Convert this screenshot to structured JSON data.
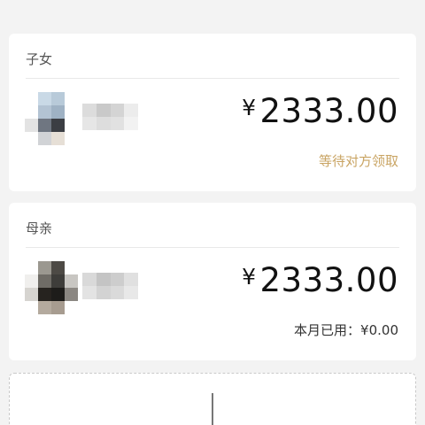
{
  "accounts": [
    {
      "relation": "子女",
      "currency": "¥",
      "amount": "2333.00",
      "status": "等待对方领取",
      "avatar_colors": [
        "#ffffff",
        "#c9d9e6",
        "#b8cad9",
        "#ffffff",
        "#ffffff",
        "#b3c3d3",
        "#9fb2c4",
        "#ffffff",
        "#e3e3e3",
        "#6f7681",
        "#3b3e43",
        "#ffffff",
        "#ffffff",
        "#d1d3d6",
        "#e6dfd6",
        "#ffffff"
      ],
      "name_blur_colors": [
        "#dcdcdc",
        "#c9c9c9",
        "#d4d4d4",
        "#ececec",
        "#e6e6e6",
        "#dddddd",
        "#e1e1e1",
        "#f2f2f2"
      ]
    },
    {
      "relation": "母亲",
      "currency": "¥",
      "amount": "2333.00",
      "usage_label": "本月已用：¥0.00",
      "avatar_colors": [
        "#ffffff",
        "#9b9890",
        "#4d4a45",
        "#ffffff",
        "#f0efed",
        "#6f6c66",
        "#3e3d3a",
        "#c8c6c2",
        "#d6d4d0",
        "#26231f",
        "#1d1c1a",
        "#8b8782",
        "#ffffff",
        "#b4aa9e",
        "#a79c90",
        "#ffffff"
      ],
      "name_blur_colors": [
        "#d9d9d9",
        "#c4c4c4",
        "#cdcdcd",
        "#e0e0e0",
        "#e3e3e3",
        "#d3d3d3",
        "#dadada",
        "#e8e8e8"
      ]
    }
  ],
  "add_button": {
    "icon": "plus-icon"
  }
}
